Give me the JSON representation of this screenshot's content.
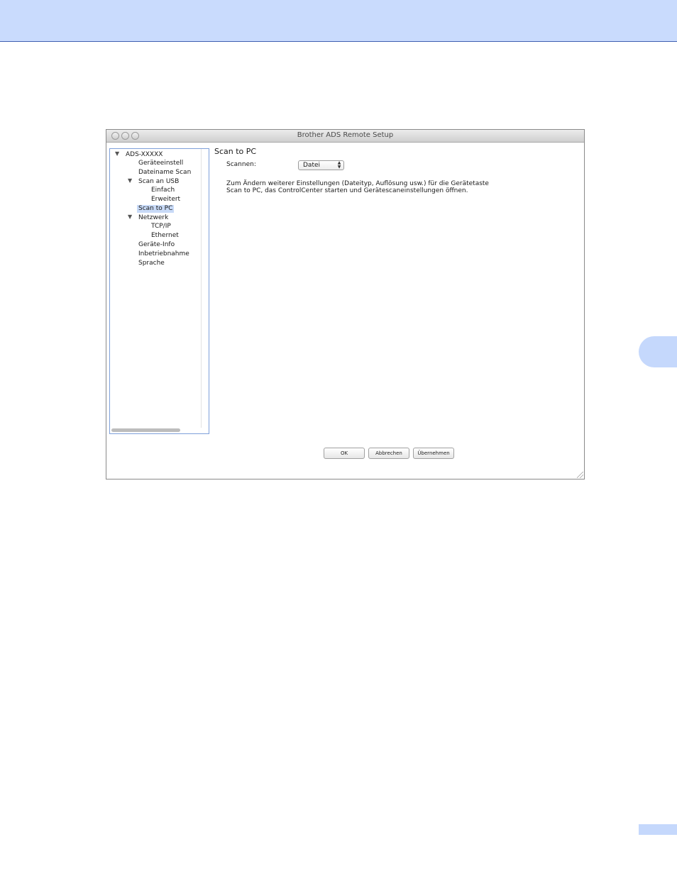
{
  "window": {
    "title": "Brother ADS Remote Setup"
  },
  "tree": {
    "items": [
      {
        "label": "ADS-XXXXX",
        "expanded": true
      },
      {
        "label": "Geräteeinstell"
      },
      {
        "label": "Dateiname Scan"
      },
      {
        "label": "Scan an USB",
        "expanded": true
      },
      {
        "label": "Einfach"
      },
      {
        "label": "Erweitert"
      },
      {
        "label": "Scan to PC",
        "selected": true
      },
      {
        "label": "Netzwerk",
        "expanded": true
      },
      {
        "label": "TCP/IP"
      },
      {
        "label": "Ethernet"
      },
      {
        "label": "Geräte-Info"
      },
      {
        "label": "Inbetriebnahme"
      },
      {
        "label": "Sprache"
      }
    ]
  },
  "panel": {
    "title": "Scan to PC",
    "scan_label": "Scannen:",
    "scan_value": "Datei",
    "description_line1": "Zum Ändern weiterer Einstellungen (Dateityp, Auflösung usw.) für die Gerätetaste",
    "description_line2": "Scan to PC, das ControlCenter starten und Gerätescaneinstellungen öffnen."
  },
  "buttons": {
    "ok": "OK",
    "cancel": "Abbrechen",
    "apply": "Übernehmen"
  },
  "colors": {
    "header_band": "#c9dbfd",
    "selection": "#c8daf7",
    "tree_border": "#7ea0da"
  }
}
